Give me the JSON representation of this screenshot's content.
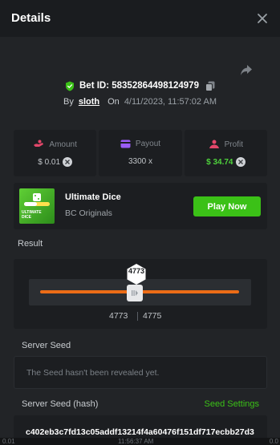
{
  "header": {
    "title": "Details"
  },
  "bet": {
    "id_text": "Bet ID: 58352864498124979",
    "by_label": "By",
    "user": "sloth",
    "on_label": "On",
    "date": "4/11/2023, 11:57:02 AM"
  },
  "stats": [
    {
      "label": "Amount",
      "value": "$ 0.01"
    },
    {
      "label": "Payout",
      "value": "3300 x"
    },
    {
      "label": "Profit",
      "value": "$ 34.74"
    }
  ],
  "game": {
    "name": "Ultimate Dice",
    "provider": "BC Originals",
    "thumb_text": "ULTIMATE DICE",
    "play_label": "Play Now"
  },
  "result": {
    "label": "Result",
    "roll": "4773",
    "range_low": "4773",
    "range_high": "4775"
  },
  "server_seed": {
    "label": "Server Seed",
    "text": "The Seed hasn't been revealed yet."
  },
  "server_seed_hash": {
    "label": "Server Seed (hash)",
    "settings_label": "Seed Settings",
    "hash": "c402eb3c7fd13c05addf13214f4a60476f151df717ecbb27d3"
  },
  "background_strip": {
    "left": "0.01",
    "center": "11:56:37 AM",
    "right": "0.0"
  },
  "colors": {
    "accent_green": "#3bc117",
    "slider_orange": "#ec6c17",
    "panel_bg": "#222427"
  }
}
